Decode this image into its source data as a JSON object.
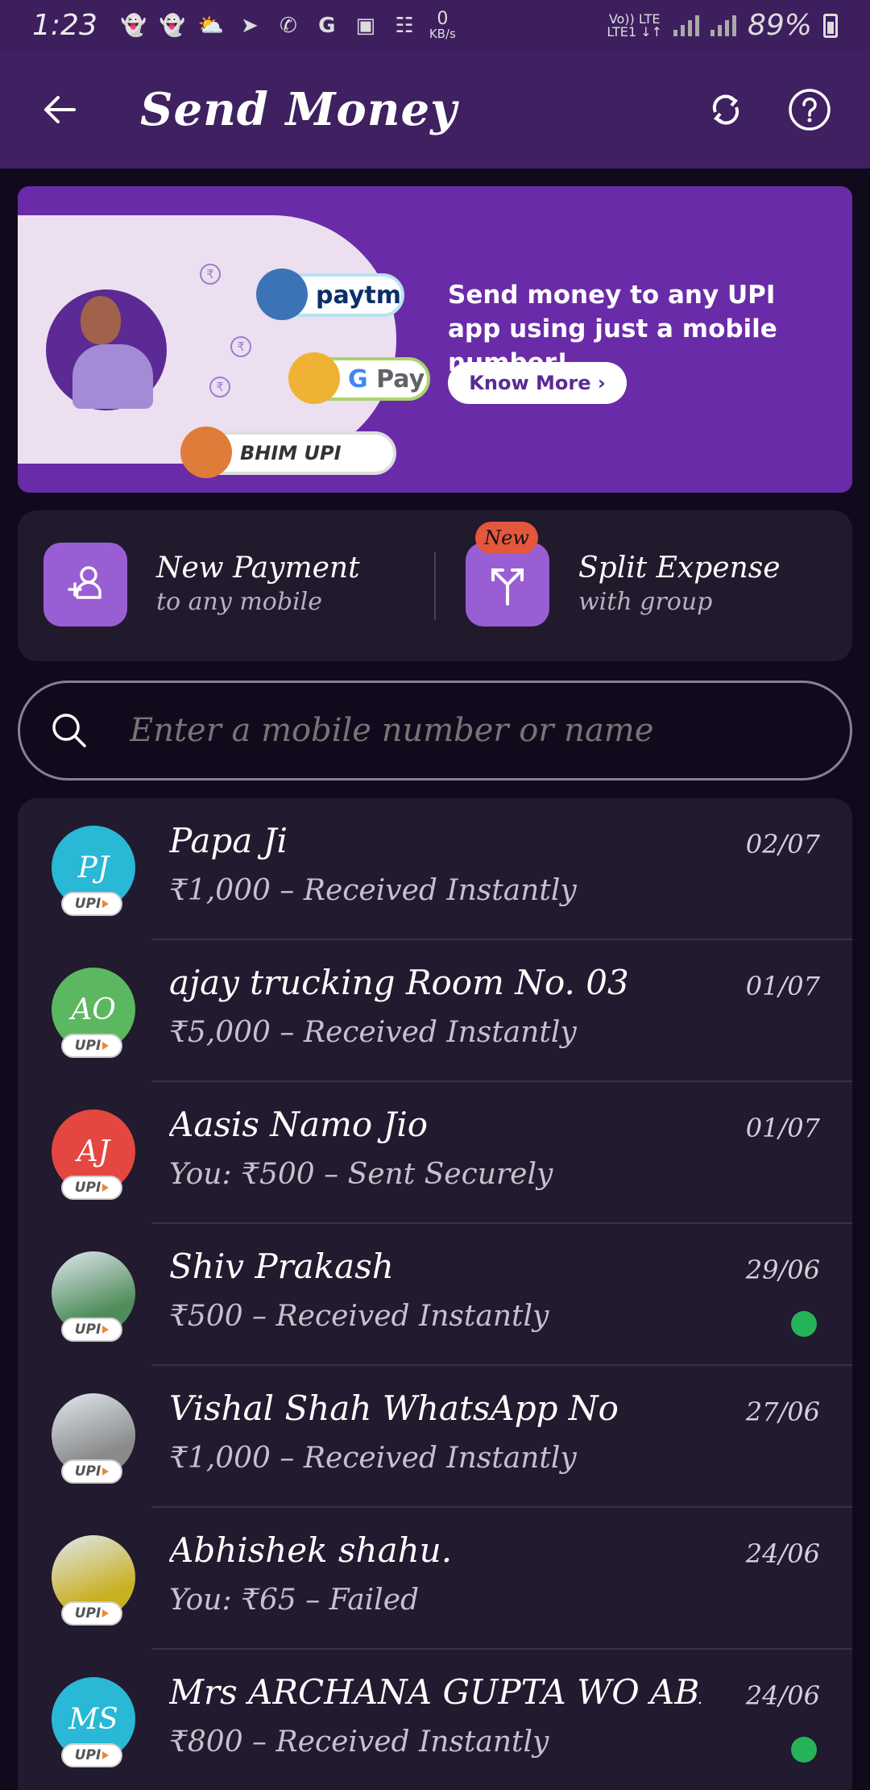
{
  "status_bar": {
    "time": "1:23",
    "net_speed_value": "0",
    "net_speed_unit": "KB/s",
    "network_top": "Vo)) LTE",
    "network_bottom": "LTE1 ↓↑",
    "battery": "89%"
  },
  "app_bar": {
    "title": "Send Money",
    "back_icon": "arrow-left-icon",
    "refresh_icon": "refresh-icon",
    "help_icon": "help-icon"
  },
  "banner": {
    "text": "Send money to any UPI app using just a mobile number!",
    "button": "Know More ›",
    "apps": [
      "paytm",
      "Pay",
      "BHIM UPI"
    ]
  },
  "actions": {
    "new_payment": {
      "title": "New Payment",
      "subtitle": "to any mobile"
    },
    "split_expense": {
      "title": "Split Expense",
      "subtitle": "with group",
      "badge": "New"
    }
  },
  "search": {
    "placeholder": "Enter a mobile number or name"
  },
  "contacts": [
    {
      "initials": "PJ",
      "name": "Papa Ji",
      "detail": "₹1,000 – Received Instantly",
      "date": "02/07",
      "avatar_color": "#29b8d6",
      "unread": false
    },
    {
      "initials": "AO",
      "name": "ajay trucking Room No. 03",
      "detail": "₹5,000 – Received Instantly",
      "date": "01/07",
      "avatar_color": "#5cb860",
      "unread": false
    },
    {
      "initials": "AJ",
      "name": "Aasis Namo Jio",
      "detail": "You: ₹500 – Sent Securely",
      "date": "01/07",
      "avatar_color": "#e4473f",
      "unread": false
    },
    {
      "initials": "",
      "name": "Shiv Prakash",
      "detail": "₹500 – Received Instantly",
      "date": "29/06",
      "avatar_color": "#4f8c5a",
      "unread": true
    },
    {
      "initials": "",
      "name": "Vishal Shah WhatsApp No",
      "detail": "₹1,000 – Received Instantly",
      "date": "27/06",
      "avatar_color": "#8a8a8a",
      "unread": false
    },
    {
      "initials": "",
      "name": "Abhishek shahu.",
      "detail": "You: ₹65 – Failed",
      "date": "24/06",
      "avatar_color": "#c9b021",
      "unread": false
    },
    {
      "initials": "MS",
      "name": "Mrs ARCHANA GUPTA WO ABHI...",
      "detail": "₹800 – Received Instantly",
      "date": "24/06",
      "avatar_color": "#29b8d6",
      "unread": true
    }
  ],
  "upi_label": "UPI"
}
